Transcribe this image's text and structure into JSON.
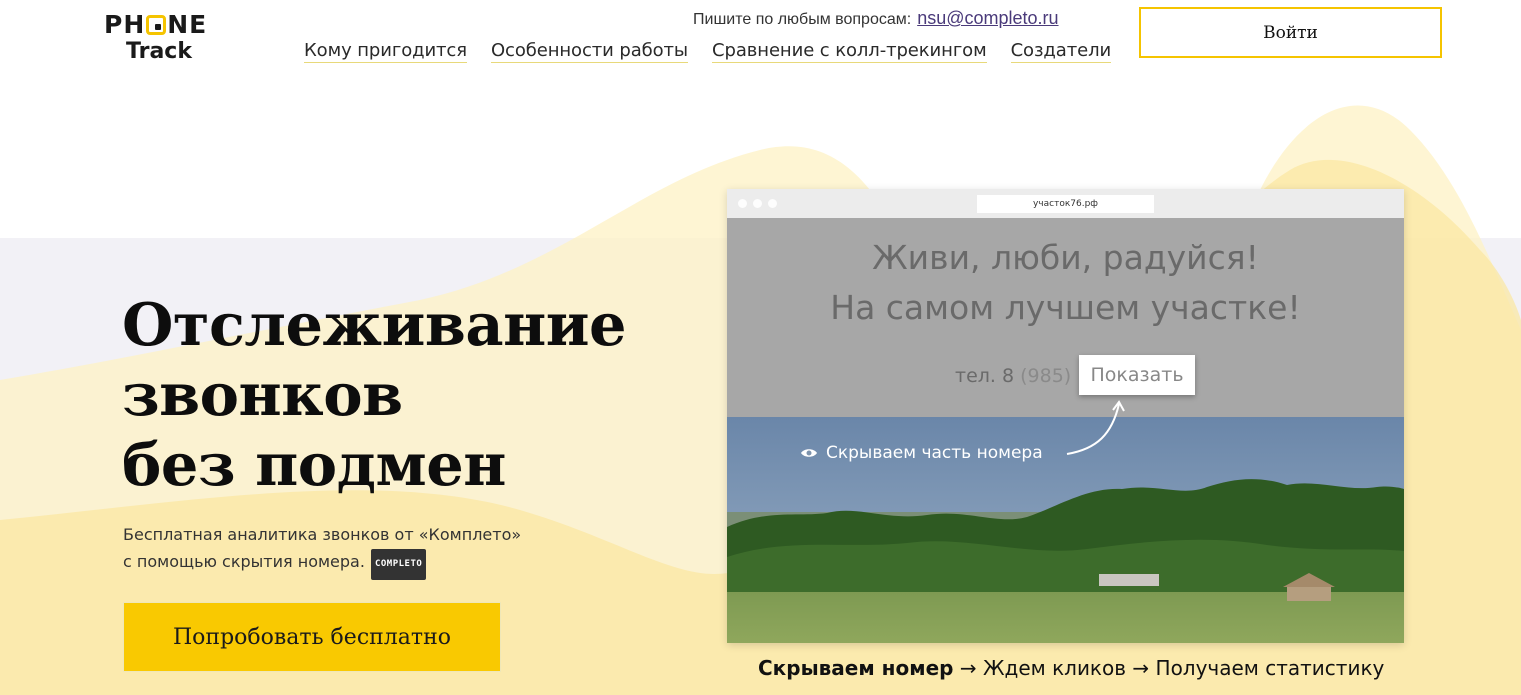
{
  "logo": {
    "line1_a": "PH",
    "line1_b": "NE",
    "line2": "Track"
  },
  "header": {
    "contact_label": "Пишите по любым вопросам:",
    "contact_email": "nsu@completo.ru",
    "nav": [
      "Кому пригодится",
      "Особенности работы",
      "Сравнение с колл-трекингом",
      "Создатели"
    ],
    "login_label": "Войти"
  },
  "hero": {
    "title_lines": [
      "Отслеживание",
      "звонков",
      "без подмен"
    ],
    "subtitle_line1": "Бесплатная аналитика звонков от «Комплето»",
    "subtitle_line2": "с помощью скрытия номера.",
    "badge": "COMPLETO",
    "cta_label": "Попробовать бесплатно"
  },
  "browser": {
    "url": "участок76.рф",
    "site_line1": "Живи, люби, радуйся!",
    "site_line2": "На самом лучшем участке!",
    "phone_prefix": "тел. 8",
    "phone_partial": "(985)",
    "show_button": "Показать",
    "hide_label": "Скрываем часть номера"
  },
  "caption": {
    "step1": "Скрываем номер",
    "arrow": "→",
    "step2": "Ждем кликов",
    "step3": "Получаем статистику"
  },
  "colors": {
    "accent": "#f9c901",
    "band": "#f2f1f6",
    "link": "#4a3a7a"
  }
}
